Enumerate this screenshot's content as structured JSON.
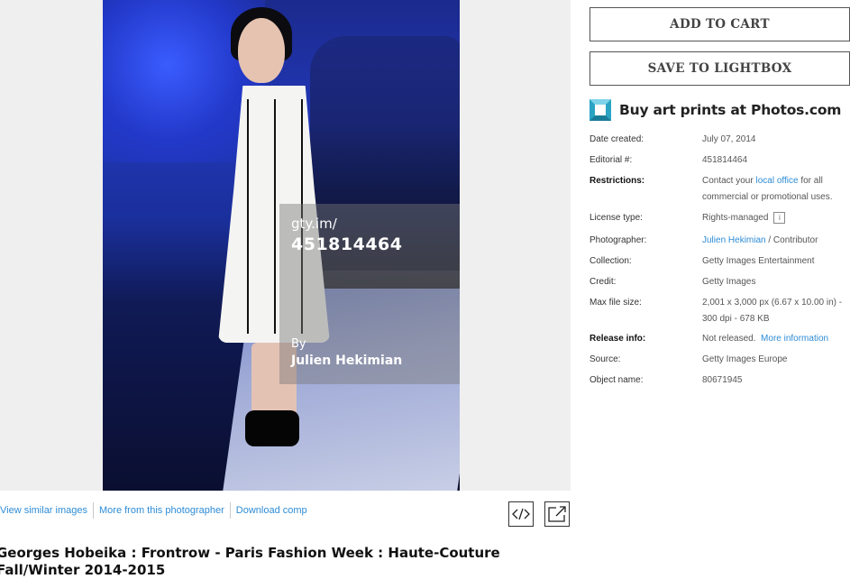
{
  "image": {
    "watermark_site": "gty.im/",
    "watermark_id": "451814464",
    "watermark_by": "By",
    "watermark_photographer": "Julien Hekimian"
  },
  "links": {
    "similar": "View similar images",
    "more_photographer": "More from this photographer",
    "download_comp": "Download comp"
  },
  "icons": {
    "embed": "embed-code-icon",
    "expand": "expand-icon",
    "photos_logo": "photos-logo-icon",
    "info": "info-icon"
  },
  "title": "Georges Hobeika : Frontrow - Paris Fashion Week : Haute-Couture Fall/Winter 2014-2015",
  "actions": {
    "add_to_cart": "ADD TO CART",
    "save_to_lightbox": "SAVE TO LIGHTBOX"
  },
  "prints": {
    "text": "Buy art prints at Photos.com"
  },
  "details": {
    "date_created": {
      "label": "Date created:",
      "value": "July 07, 2014"
    },
    "editorial": {
      "label": "Editorial #:",
      "value": "451814464"
    },
    "restrictions": {
      "label": "Restrictions:",
      "prefix": "Contact your ",
      "link": "local office",
      "suffix": " for all commercial or promotional uses."
    },
    "license": {
      "label": "License type:",
      "value": "Rights-managed",
      "info_glyph": "i"
    },
    "photographer": {
      "label": "Photographer:",
      "link": "Julien Hekimian",
      "suffix": " / Contributor"
    },
    "collection": {
      "label": "Collection:",
      "value": "Getty Images Entertainment"
    },
    "credit": {
      "label": "Credit:",
      "value": "Getty Images"
    },
    "max_file_size": {
      "label": "Max file size:",
      "value": "2,001 x 3,000 px (6.67 x 10.00 in) - 300 dpi - 678 KB"
    },
    "release": {
      "label": "Release info:",
      "value": "Not released.",
      "link": "More information"
    },
    "source": {
      "label": "Source:",
      "value": "Getty Images Europe"
    },
    "object_name": {
      "label": "Object name:",
      "value": "80671945"
    }
  },
  "colors": {
    "link": "#2e8cd6",
    "logo_teal": "#2aa3c4"
  }
}
